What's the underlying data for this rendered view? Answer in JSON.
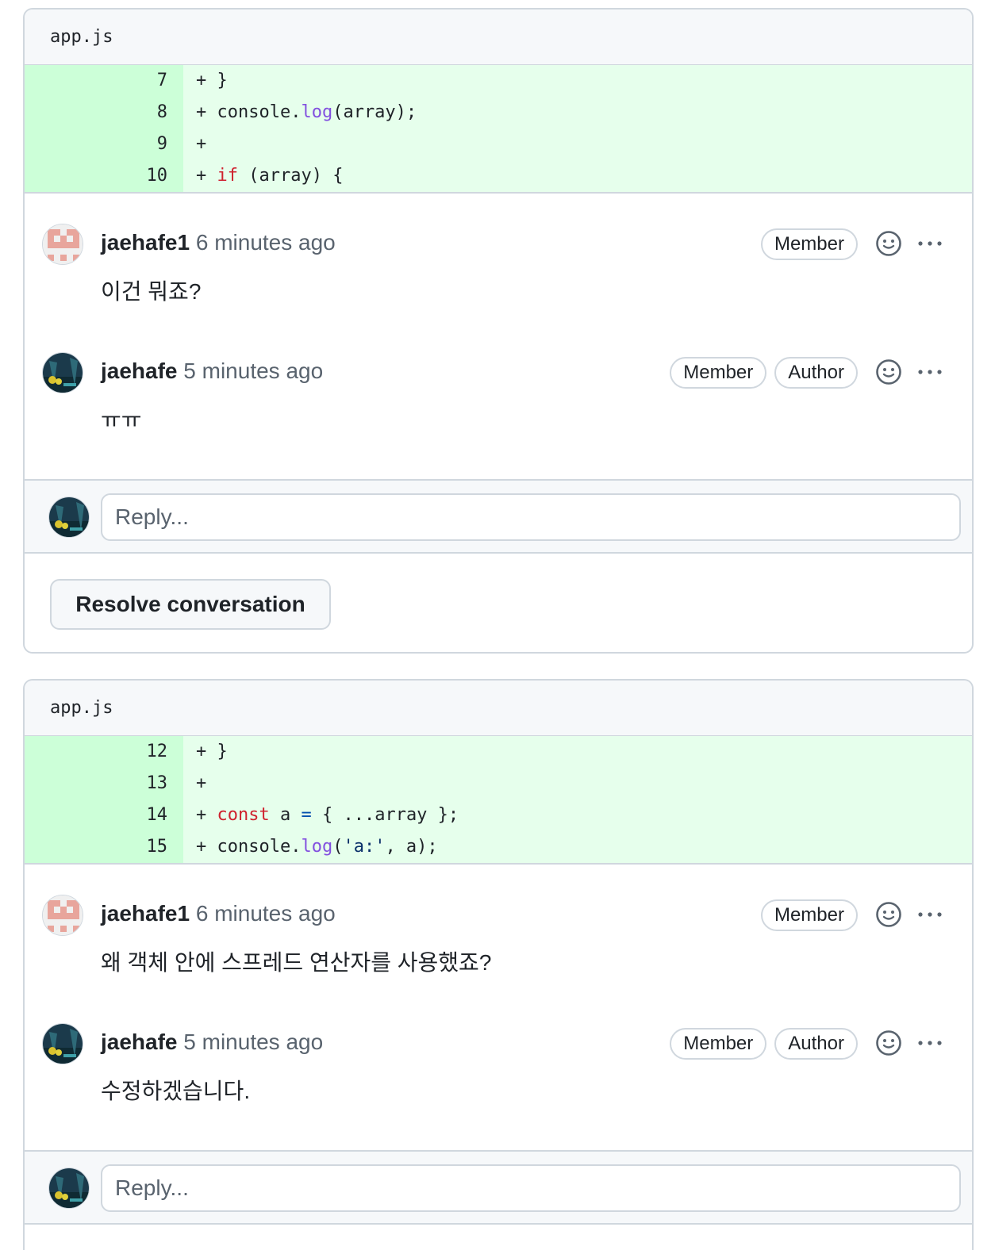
{
  "threads": [
    {
      "file": "app.js",
      "lines": [
        {
          "num": "7",
          "code": "+ }"
        },
        {
          "num": "8",
          "code": "+ console.log(array);"
        },
        {
          "num": "9",
          "code": "+"
        },
        {
          "num": "10",
          "code": "+ if (array) {"
        }
      ],
      "comments": [
        {
          "author": "jaehafe1",
          "time": "6 minutes ago",
          "badges": [
            "Member"
          ],
          "body": "이건 뭐죠?",
          "avatar": "identicon"
        },
        {
          "author": "jaehafe",
          "time": "5 minutes ago",
          "badges": [
            "Member",
            "Author"
          ],
          "body": "ㅠㅠ",
          "avatar": "photo"
        }
      ],
      "reply_placeholder": "Reply...",
      "resolve_label": "Resolve conversation"
    },
    {
      "file": "app.js",
      "lines": [
        {
          "num": "12",
          "code": "+ }"
        },
        {
          "num": "13",
          "code": "+"
        },
        {
          "num": "14",
          "code": "+ const a = { ...array };"
        },
        {
          "num": "15",
          "code": "+ console.log('a:', a);"
        }
      ],
      "comments": [
        {
          "author": "jaehafe1",
          "time": "6 minutes ago",
          "badges": [
            "Member"
          ],
          "body": "왜 객체 안에 스프레드 연산자를 사용했죠?",
          "avatar": "identicon"
        },
        {
          "author": "jaehafe",
          "time": "5 minutes ago",
          "badges": [
            "Member",
            "Author"
          ],
          "body": "수정하겠습니다.",
          "avatar": "photo"
        }
      ],
      "reply_placeholder": "Reply..."
    }
  ],
  "colors": {
    "line_num_bg": "#ccffd8",
    "code_bg": "#e6ffec",
    "border": "#d0d7de",
    "keyword": "#cf222e",
    "function": "#8250df",
    "string": "#0a3069"
  }
}
